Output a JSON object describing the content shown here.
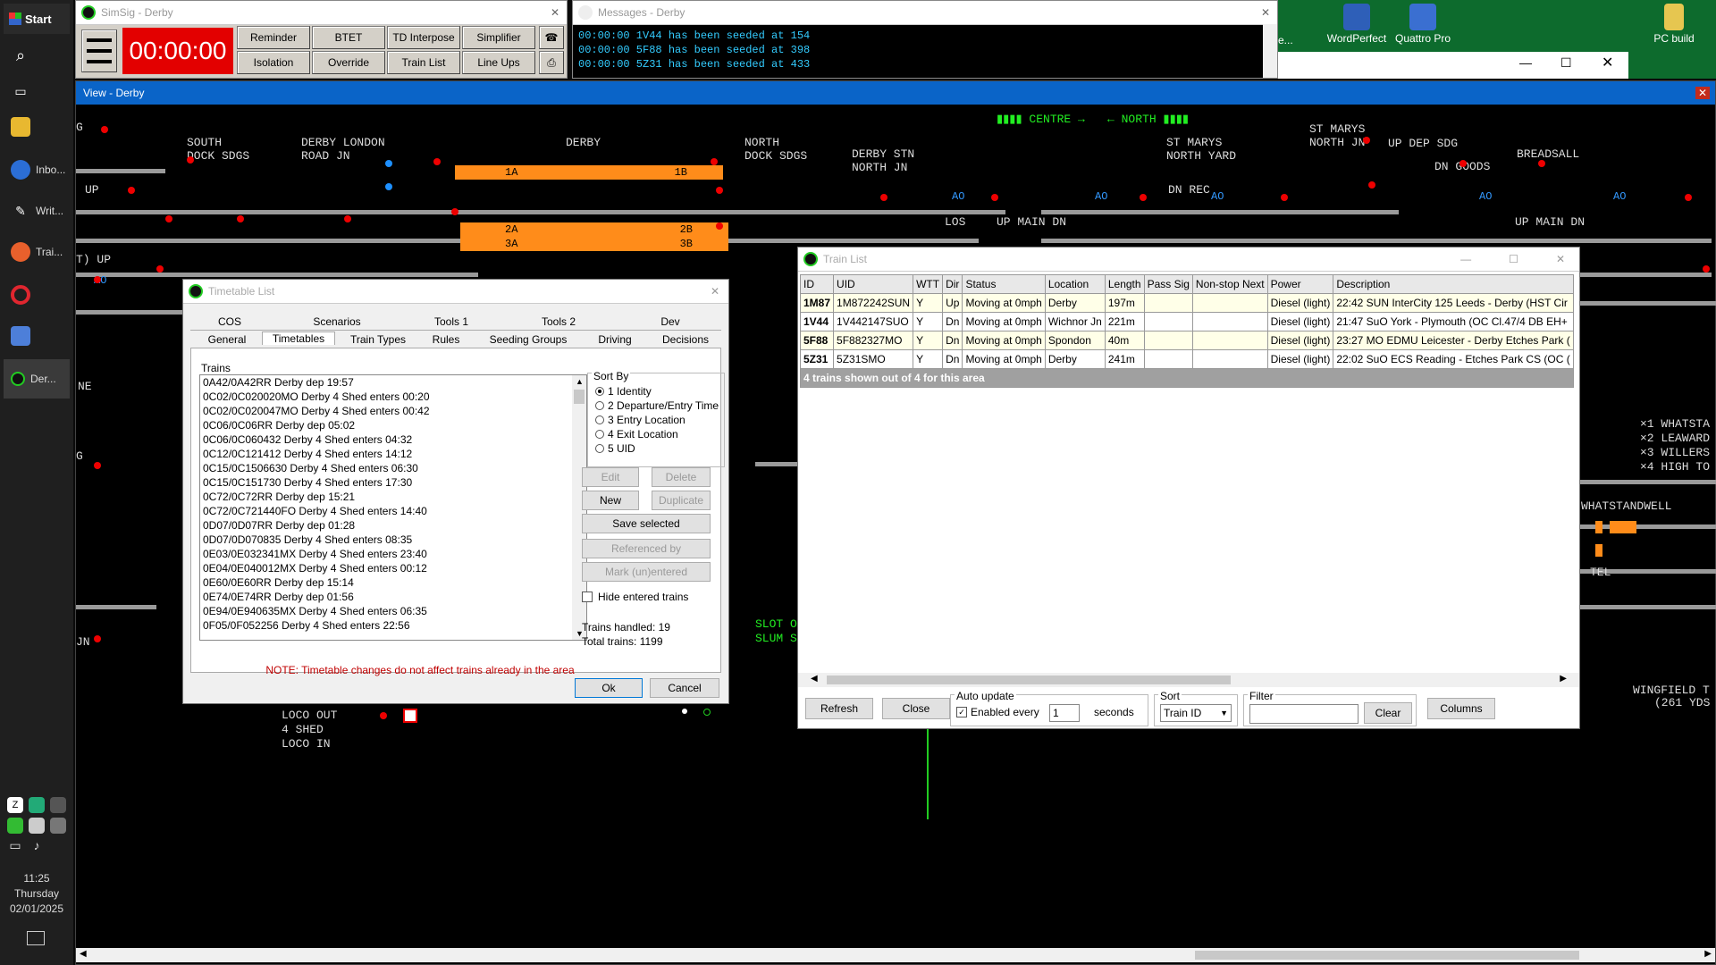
{
  "taskbar": {
    "start_label": "Start",
    "items": [
      "Inbo...",
      "Writ...",
      "Trai...",
      "Der..."
    ],
    "clock": {
      "time": "11:25",
      "day": "Thursday",
      "date": "02/01/2025"
    }
  },
  "desktop": {
    "icons": [
      "WordPerfect",
      "Quattro Pro",
      "PC build"
    ],
    "partial_icon": "e..."
  },
  "simsig": {
    "title": "SimSig - Derby",
    "clock": "00:00:00",
    "buttons": [
      "Reminder",
      "BTET",
      "TD Interpose",
      "Simplifier",
      "Isolation",
      "Override",
      "Train List",
      "Line Ups"
    ]
  },
  "messages": {
    "title": "Messages - Derby",
    "lines": [
      "00:00:00 1V44 has been seeded at 154",
      "00:00:00 5F88 has been seeded at 398",
      "00:00:00 5Z31 has been seeded at 433"
    ]
  },
  "view": {
    "title": "View - Derby",
    "labels": {
      "south_dock": "SOUTH\nDOCK SDGS",
      "london_road": "DERBY LONDON\nROAD JN",
      "derby": "DERBY",
      "north_dock": "NORTH\nDOCK SDGS",
      "derby_stn_north": "DERBY STN\nNORTH JN",
      "st_marys_nyard": "ST MARYS\nNORTH YARD",
      "st_marys_njn": "ST MARYS\nNORTH JN",
      "up_dep_sdg": "UP DEP SDG",
      "breadsall": "BREADSALL",
      "dn_goods": "DN GOODS",
      "dn_rec": "DN REC",
      "up": "UP",
      "t_up": "T) UP",
      "ne": "NE",
      "g1": "G",
      "g2": "G",
      "jn": "JN",
      "loco_out": "LOCO OUT",
      "shed4": "4 SHED",
      "loco_in": "LOCO IN",
      "centre": "CENTRE",
      "north": "NORTH",
      "los": "LOS",
      "up_main_dn1": "UP MAIN DN",
      "up_main_dn2": "UP MAIN DN",
      "slot": "SLOT O",
      "slum": "SLUM S",
      "whatstandwell": "WHATSTANDWELL",
      "tel": "TEL",
      "wingfield": "WINGFIELD T",
      "yds": "(261 YDS",
      "x1": "×1 WHATSTA",
      "x2": "×2 LEAWARD",
      "x3": "×3 WILLERS",
      "x4": "×4 HIGH TO"
    },
    "platforms": [
      {
        "left": "1A",
        "right": "1B"
      },
      {
        "left": "2A",
        "right": "2B"
      },
      {
        "left": "3A",
        "right": "3B"
      }
    ],
    "aspect_tag": "AO"
  },
  "timetable": {
    "title": "Timetable List",
    "tabs_row1": [
      "COS",
      "Scenarios",
      "Tools 1",
      "Tools 2",
      "Dev"
    ],
    "tabs_row2": [
      "General",
      "Timetables",
      "Train Types",
      "Rules",
      "Seeding Groups",
      "Driving",
      "Decisions"
    ],
    "trains_label": "Trains",
    "trains": [
      "0A42/0A42RR Derby dep 19:57",
      "0C02/0C020020MO Derby 4 Shed enters 00:20",
      "0C02/0C020047MO Derby 4 Shed enters 00:42",
      "0C06/0C06RR Derby dep 05:02",
      "0C06/0C060432 Derby 4 Shed enters 04:32",
      "0C12/0C121412 Derby 4 Shed enters 14:12",
      "0C15/0C1506630 Derby 4 Shed enters 06:30",
      "0C15/0C151730 Derby 4 Shed enters 17:30",
      "0C72/0C72RR Derby dep 15:21",
      "0C72/0C721440FO Derby 4 Shed enters 14:40",
      "0D07/0D07RR Derby dep 01:28",
      "0D07/0D070835 Derby 4 Shed enters 08:35",
      "0E03/0E032341MX Derby 4 Shed enters 23:40",
      "0E04/0E040012MX Derby 4 Shed enters 00:12",
      "0E60/0E60RR Derby dep 15:14",
      "0E74/0E74RR Derby dep 01:56",
      "0E94/0E940635MX Derby 4 Shed enters 06:35",
      "0F05/0F052256 Derby 4 Shed enters 22:56"
    ],
    "sort_by_label": "Sort By",
    "sort_options": [
      "1 Identity",
      "2 Departure/Entry Time",
      "3 Entry Location",
      "4 Exit Location",
      "5 UID"
    ],
    "buttons": {
      "edit": "Edit",
      "delete": "Delete",
      "new": "New",
      "duplicate": "Duplicate",
      "save_selected": "Save selected",
      "referenced_by": "Referenced by",
      "mark_unentered": "Mark (un)entered"
    },
    "hide_entered": "Hide entered trains",
    "trains_handled": "Trains handled: 19",
    "total_trains": "Total trains: 1199",
    "note": "NOTE: Timetable changes do not affect trains already in the area",
    "ok": "Ok",
    "cancel": "Cancel"
  },
  "trainlist": {
    "title": "Train List",
    "columns": [
      "ID",
      "UID",
      "WTT",
      "Dir",
      "Status",
      "Location",
      "Length",
      "Pass Sig",
      "Non-stop Next",
      "Power",
      "Description"
    ],
    "rows": [
      [
        "1M87",
        "1M872242SUN",
        "Y",
        "Up",
        "Moving at 0mph",
        "Derby",
        "197m",
        "",
        "",
        "Diesel (light)",
        "22:42 SUN InterCity 125 Leeds - Derby (HST Cir"
      ],
      [
        "1V44",
        "1V442147SUO",
        "Y",
        "Dn",
        "Moving at 0mph",
        "Wichnor Jn",
        "221m",
        "",
        "",
        "Diesel (light)",
        "21:47 SuO York - Plymouth (OC Cl.47/4 DB EH+"
      ],
      [
        "5F88",
        "5F882327MO",
        "Y",
        "Dn",
        "Moving at 0mph",
        "Spondon",
        "40m",
        "",
        "",
        "Diesel (light)",
        "23:27 MO EDMU Leicester - Derby Etches Park ("
      ],
      [
        "5Z31",
        "5Z31SMO",
        "Y",
        "Dn",
        "Moving at 0mph",
        "Derby",
        "241m",
        "",
        "",
        "Diesel (light)",
        "22:02 SuO ECS Reading - Etches Park CS (OC ("
      ]
    ],
    "summary": "4 trains shown out of 4 for this area",
    "refresh": "Refresh",
    "close": "Close",
    "auto_update": "Auto update",
    "enabled_every": "Enabled every",
    "interval": "1",
    "seconds": "seconds",
    "sort_label": "Sort",
    "sort_value": "Train ID",
    "filter_label": "Filter",
    "clear": "Clear",
    "columns_btn": "Columns"
  }
}
